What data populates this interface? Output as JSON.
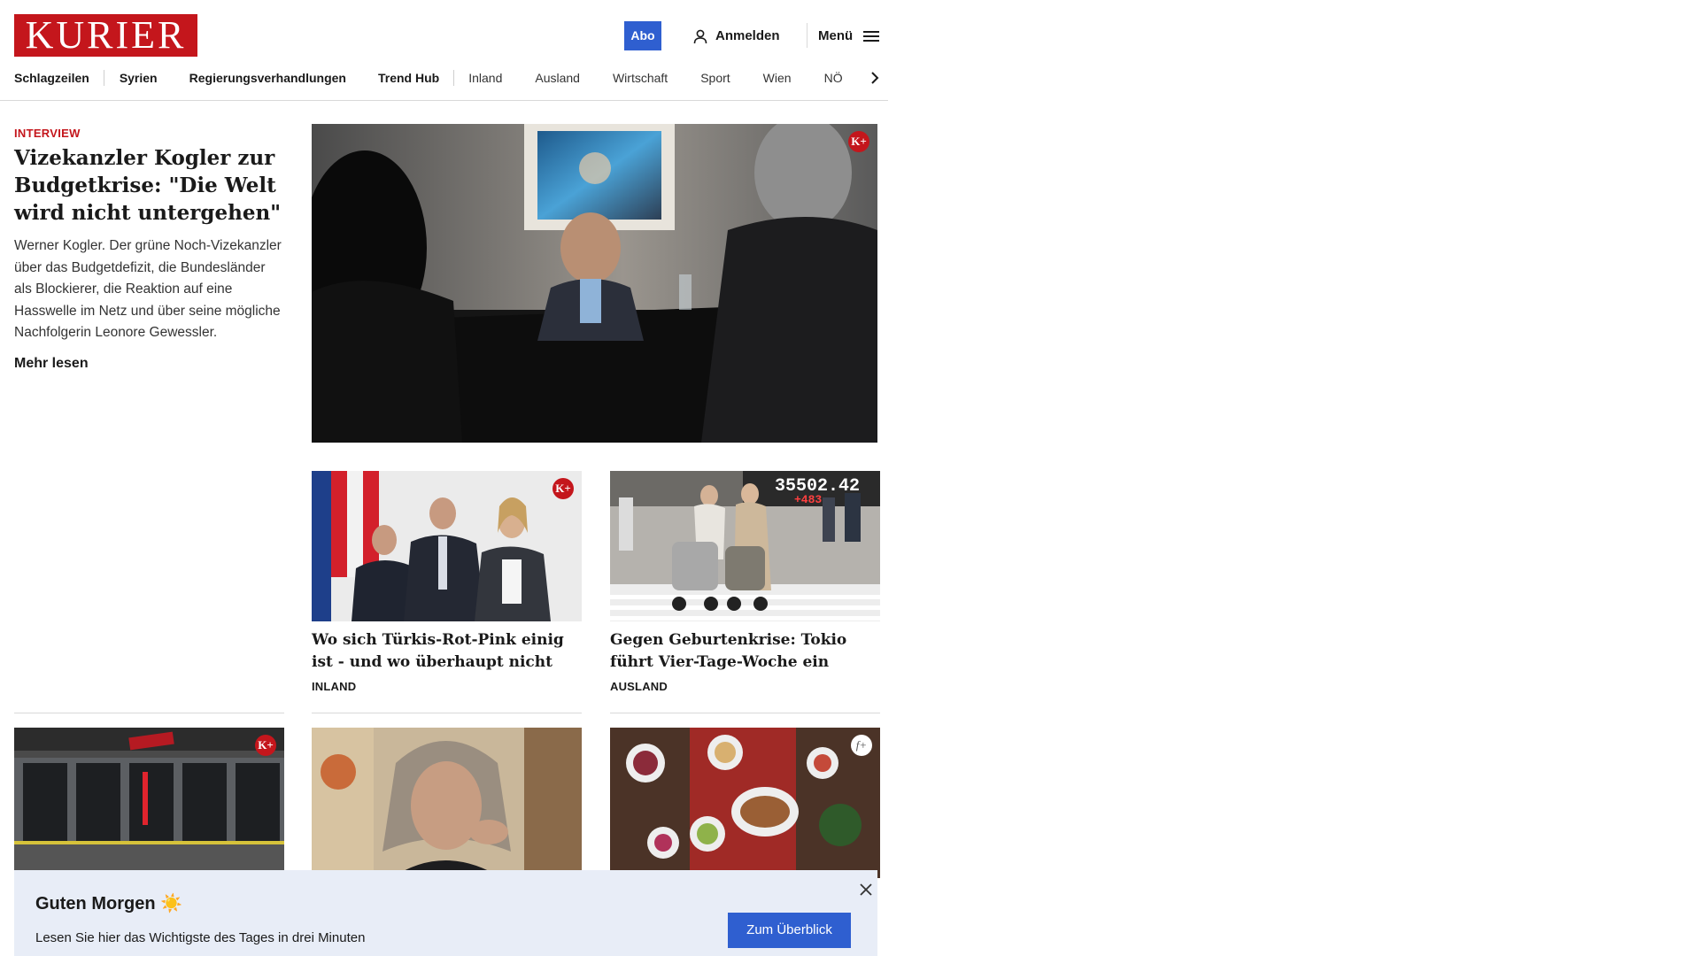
{
  "header": {
    "logo_text": "KURIER",
    "abo_label": "Abo",
    "login_label": "Anmelden",
    "menu_label": "Menü",
    "brand_color": "#c4161c",
    "accent_color": "#2f5fd0"
  },
  "nav": {
    "items": [
      {
        "label": "Schlagzeilen"
      },
      {
        "label": "Syrien"
      },
      {
        "label": "Regierungsverhandlungen"
      },
      {
        "label": "Trend Hub"
      },
      {
        "label": "Inland"
      },
      {
        "label": "Ausland"
      },
      {
        "label": "Wirtschaft"
      },
      {
        "label": "Sport"
      },
      {
        "label": "Wien"
      },
      {
        "label": "NÖ"
      }
    ]
  },
  "lead": {
    "kicker": "INTERVIEW",
    "title": "Vizekanzler Kogler zur Budgetkrise: \"Die Welt wird nicht untergehen\"",
    "teaser": "Werner Kogler. Der grüne Noch-Vizekanzler über das Budgetdefizit, die Bundesländer als Blockierer, die Reaktion auf eine Hasswelle im Netz und über seine mögliche Nachfolgerin Leonore Gewessler.",
    "more_label": "Mehr lesen",
    "badge": "K+"
  },
  "cards": [
    {
      "title": "Wo sich Türkis-Rot-Pink einig ist - und wo überhaupt nicht",
      "category": "INLAND",
      "badge": "K+"
    },
    {
      "title": "Gegen Geburtenkrise: Tokio führt Vier-Tage-Woche ein",
      "category": "AUSLAND",
      "ticker_value": "35502.42",
      "ticker_change": "+483."
    }
  ],
  "row3": [
    {
      "badge": "K+"
    },
    {},
    {
      "badge": "f+"
    }
  ],
  "banner": {
    "title": "Guten Morgen",
    "emoji": "☀️",
    "subtitle": "Lesen Sie hier das Wichtigste des Tages in drei Minuten",
    "button_label": "Zum Überblick"
  }
}
